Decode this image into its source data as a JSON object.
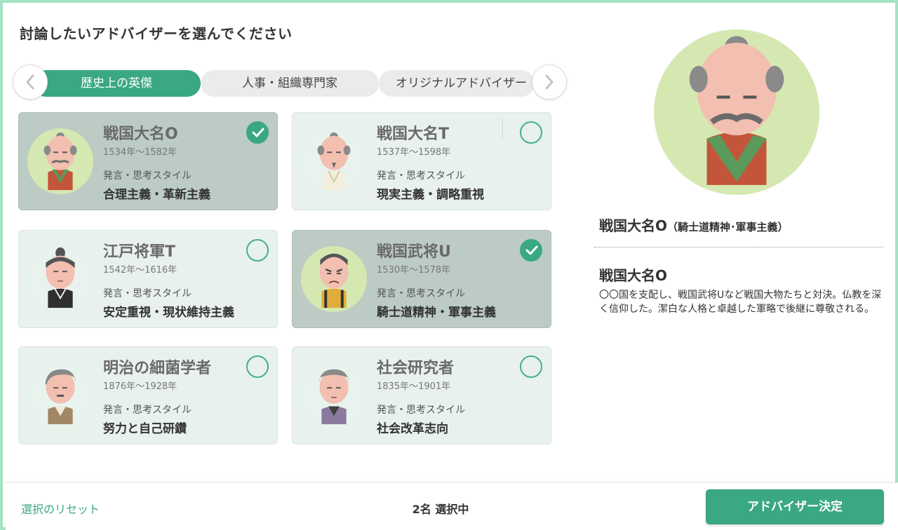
{
  "page": {
    "title": "討論したいアドバイザーを選んでください"
  },
  "tabs": [
    {
      "label": "歴史上の英傑",
      "active": true
    },
    {
      "label": "人事・組織専門家",
      "active": false
    },
    {
      "label": "オリジナルアドバイザー",
      "active": false
    }
  ],
  "nav": {
    "prev_icon": "chevron-left-icon",
    "next_icon": "chevron-right-icon"
  },
  "advisors": [
    {
      "name": "戦国大名O",
      "years": "1534年〜1582年",
      "style_label": "発言・思考スタイル",
      "style": "合理主義・革新主義",
      "selected": true
    },
    {
      "name": "戦国大名T",
      "years": "1537年〜1598年",
      "style_label": "発言・思考スタイル",
      "style": "現実主義・調略重視",
      "selected": false
    },
    {
      "name": "江戸将軍T",
      "years": "1542年〜1616年",
      "style_label": "発言・思考スタイル",
      "style": "安定重視・現状維持主義",
      "selected": false
    },
    {
      "name": "戦国武将U",
      "years": "1530年〜1578年",
      "style_label": "発言・思考スタイル",
      "style": "騎士道精神・軍事主義",
      "selected": true
    },
    {
      "name": "明治の細菌学者",
      "years": "1876年〜1928年",
      "style_label": "発言・思考スタイル",
      "style": "努力と自己研鑽",
      "selected": false
    },
    {
      "name": "社会研究者",
      "years": "1835年〜1901年",
      "style_label": "発言・思考スタイル",
      "style": "社会改革志向",
      "selected": false
    }
  ],
  "detail": {
    "heading": "戦国大名O",
    "heading_sub": "（騎士道精神･軍事主義）",
    "name": "戦国大名O",
    "description": "〇〇国を支配し、戦国武将Uなど戦国大物たちと対決。仏教を深く信仰した。潔白な人格と卓越した軍略で後継に尊敬される。"
  },
  "footer": {
    "reset_label": "選択のリセット",
    "count_label": "2名 選択中",
    "decide_label": "アドバイザー決定"
  },
  "colors": {
    "accent": "#3aa882",
    "frame": "#a6e2c4",
    "card_bg": "#e8f1ec",
    "card_selected_bg": "#bccbc4"
  }
}
